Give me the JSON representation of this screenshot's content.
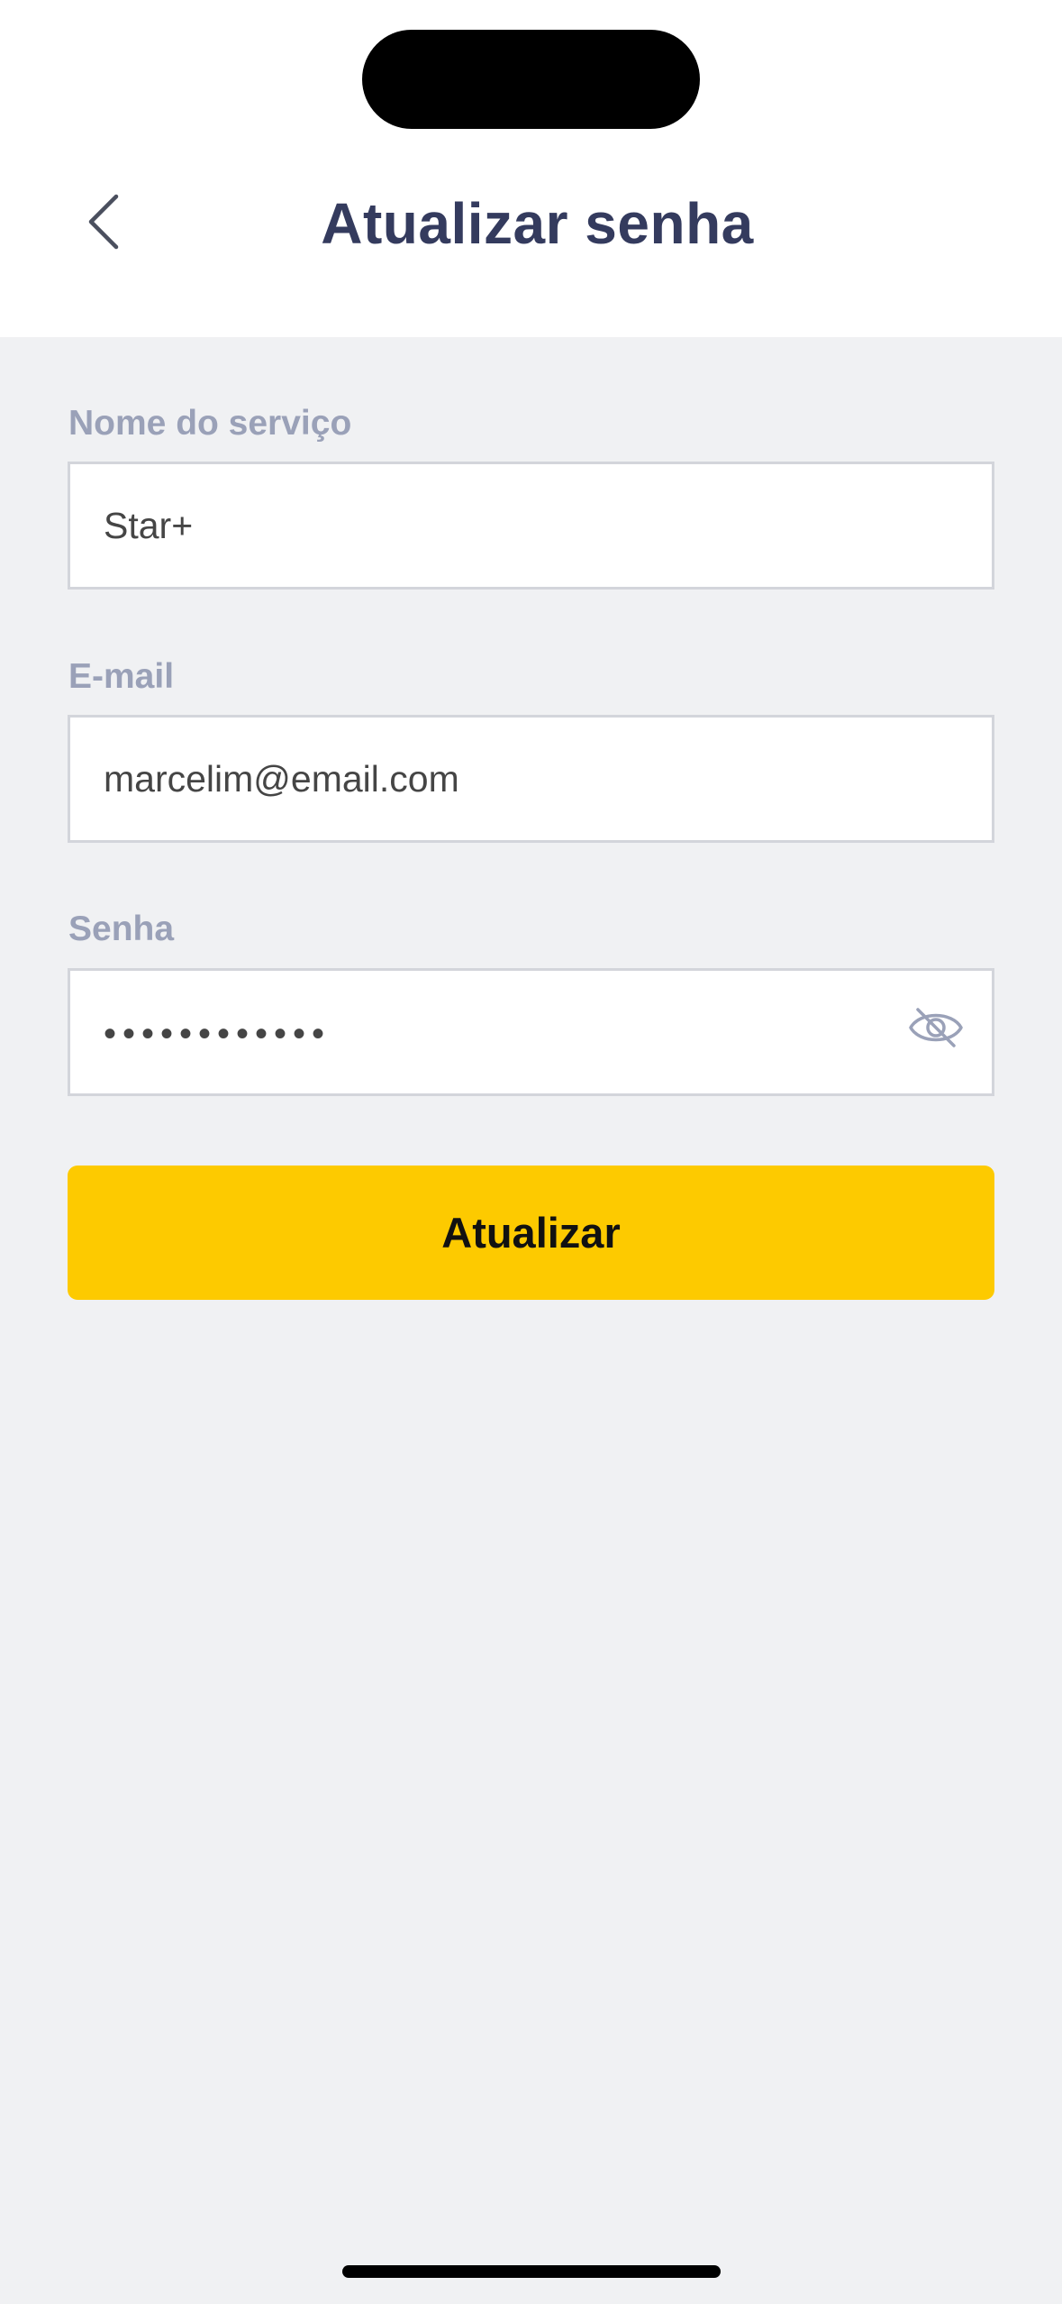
{
  "header": {
    "title": "Atualizar senha",
    "back_icon": "chevron-left-icon"
  },
  "form": {
    "service_name": {
      "label": "Nome do serviço",
      "value": "Star+"
    },
    "email": {
      "label": "E-mail",
      "value": "marcelim@email.com"
    },
    "password": {
      "label": "Senha",
      "masked_value": "••••••••••••",
      "visibility_icon": "eye-off-icon"
    },
    "submit_label": "Atualizar"
  },
  "colors": {
    "title": "#343b5e",
    "label": "#9aa1b8",
    "accent": "#fdca00",
    "background": "#f0f1f3"
  }
}
